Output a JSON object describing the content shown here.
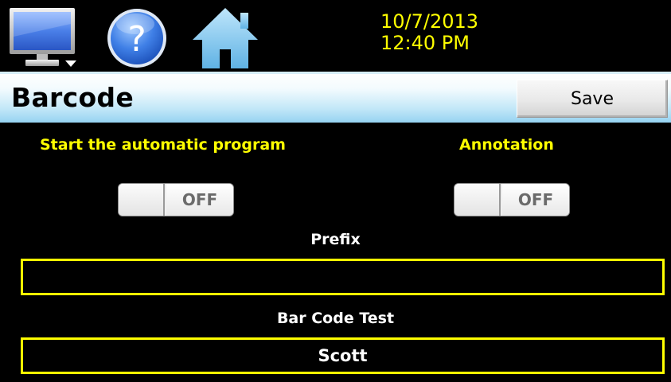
{
  "topbar": {
    "icons": {
      "monitor": "monitor-icon",
      "help": "help-icon",
      "home": "home-icon"
    },
    "date": "10/7/2013",
    "time": "12:40 PM"
  },
  "header": {
    "title": "Barcode",
    "save_label": "Save"
  },
  "settings": {
    "autostart": {
      "label": "Start the automatic program",
      "state": "OFF"
    },
    "annotation": {
      "label": "Annotation",
      "state": "OFF"
    },
    "prefix": {
      "label": "Prefix",
      "value": ""
    },
    "barcode_test": {
      "label": "Bar Code Test",
      "value": "Scott"
    }
  },
  "colors": {
    "background": "#000000",
    "accent_text": "#ffff00",
    "field_border": "#ffff00",
    "title_bar": "#c4e8f8"
  }
}
